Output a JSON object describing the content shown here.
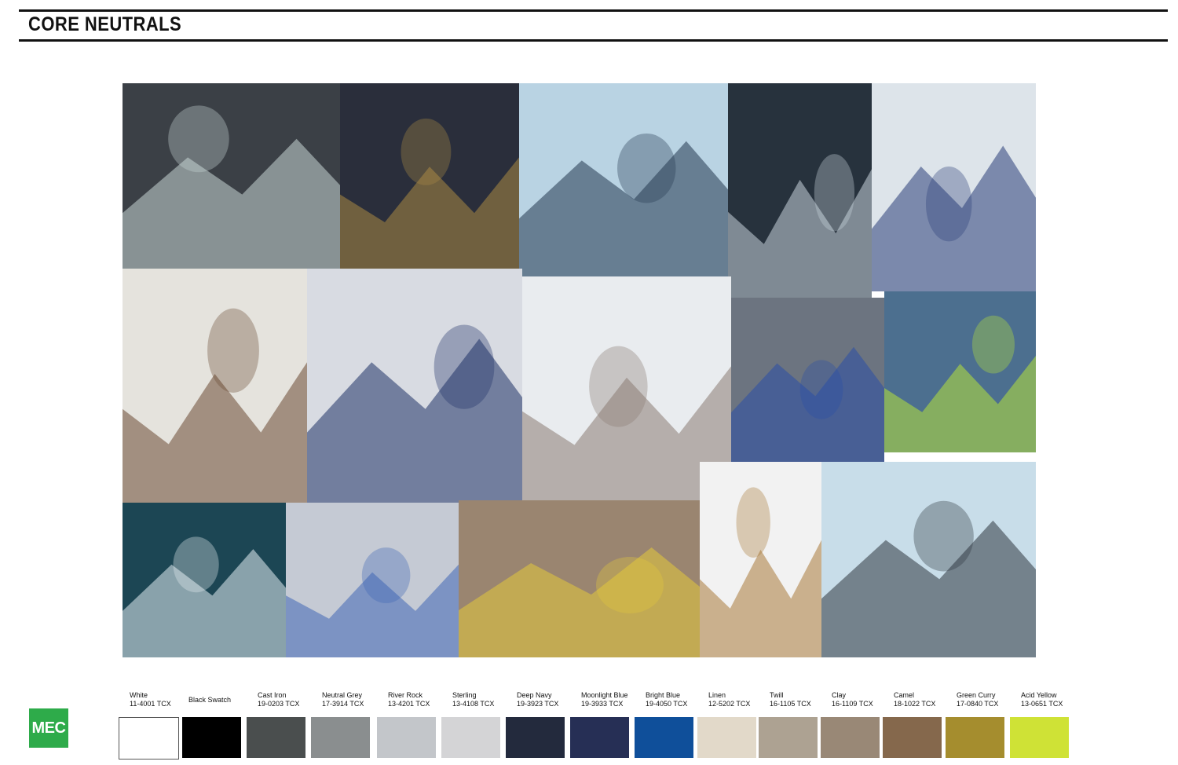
{
  "header": {
    "title": "CORE NEUTRALS"
  },
  "brand": {
    "logo_text": "MEC",
    "logo_color": "#2eab4a"
  },
  "moodboard": {
    "tiles": [
      {
        "name": "basalt-sea-cliff-photo",
        "bg": "#3b4046",
        "accent": "#c9d6d6"
      },
      {
        "name": "printed-jacket-photo",
        "bg": "#2a2e3b",
        "accent": "#a98a44"
      },
      {
        "name": "skier-in-snowstorm-photo",
        "bg": "#b9d3e3",
        "accent": "#253850"
      },
      {
        "name": "frozen-lake-bubbles-photo",
        "bg": "#27323d",
        "accent": "#c9d4dc"
      },
      {
        "name": "expedition-climbers-photo",
        "bg": "#dde4ea",
        "accent": "#2a3e78"
      },
      {
        "name": "vintage-suv-with-dog-photo",
        "bg": "#e5e3dd",
        "accent": "#6b4a33"
      },
      {
        "name": "mountaineers-on-slope-photo",
        "bg": "#d8dbe2",
        "accent": "#1f3266"
      },
      {
        "name": "snowy-volcano-photo",
        "bg": "#e9ecef",
        "accent": "#8a7c72"
      },
      {
        "name": "terrazzo-texture-photo",
        "bg": "#6c7480",
        "accent": "#2c4fa6"
      },
      {
        "name": "alpine-ridge-climber-photo",
        "bg": "#4c6f8f",
        "accent": "#b7e13a"
      },
      {
        "name": "ice-bubbles-closeup-photo",
        "bg": "#1c4654",
        "accent": "#e4eef2"
      },
      {
        "name": "abstract-paper-collage-photo",
        "bg": "#c5cad4",
        "accent": "#3f66b4"
      },
      {
        "name": "yellow-land-rover-photo",
        "bg": "#9a8570",
        "accent": "#e3c93c"
      },
      {
        "name": "man-in-quilted-vest-photo",
        "bg": "#f2f2f2",
        "accent": "#a97a3a"
      },
      {
        "name": "ice-climber-photo",
        "bg": "#c8dde9",
        "accent": "#2f3640"
      }
    ]
  },
  "swatches": [
    {
      "name": "White",
      "code": "11-4001 TCX",
      "color": "#ffffff"
    },
    {
      "name": "Black Swatch",
      "code": "",
      "color": "#000000"
    },
    {
      "name": "Cast Iron",
      "code": "19-0203 TCX",
      "color": "#4a4e4e"
    },
    {
      "name": "Neutral Grey",
      "code": "17-3914 TCX",
      "color": "#8a8e8f"
    },
    {
      "name": "River Rock",
      "code": "13-4201 TCX",
      "color": "#c3c6ca"
    },
    {
      "name": "Sterling",
      "code": "13-4108 TCX",
      "color": "#d4d4d6"
    },
    {
      "name": "Deep Navy",
      "code": "19-3923 TCX",
      "color": "#232a3d"
    },
    {
      "name": "Moonlight Blue",
      "code": "19-3933 TCX",
      "color": "#262f55"
    },
    {
      "name": "Bright Blue",
      "code": "19-4050 TCX",
      "color": "#0f4f9a"
    },
    {
      "name": "Linen",
      "code": "12-5202 TCX",
      "color": "#e2d9c9"
    },
    {
      "name": "Twill",
      "code": "16-1105 TCX",
      "color": "#ada292"
    },
    {
      "name": "Clay",
      "code": "16-1109  TCX",
      "color": "#998876"
    },
    {
      "name": "Camel",
      "code": "18-1022 TCX",
      "color": "#85684c"
    },
    {
      "name": "Green Curry",
      "code": "17-0840 TCX",
      "color": "#a58d2e"
    },
    {
      "name": "Acid Yellow",
      "code": "13-0651 TCX",
      "color": "#cfe236"
    }
  ]
}
